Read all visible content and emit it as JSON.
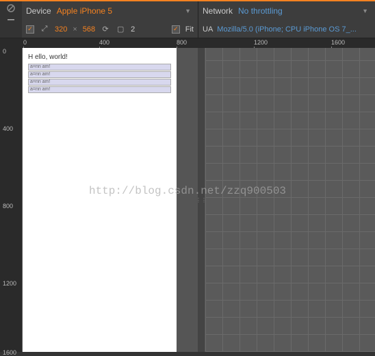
{
  "device": {
    "label": "Device",
    "selected": "Apple iPhone 5",
    "dimensions": {
      "width": "320",
      "height": "568",
      "separator": "×"
    },
    "zoom": "2",
    "fit_label": "Fit"
  },
  "network": {
    "label": "Network",
    "selected": "No throttling",
    "ua_label": "UA",
    "ua_value": "Mozilla/5.0 (iPhone; CPU iPhone OS 7_..."
  },
  "ruler": {
    "h": [
      "0",
      "400",
      "800",
      "1200",
      "1600"
    ],
    "v": [
      "0",
      "400",
      "800",
      "1200",
      "1600"
    ]
  },
  "page_content": {
    "title": "H ello, world!",
    "rows": [
      "a=nn am!",
      "a=nn am!",
      "a=nn am!",
      "a=nn am!"
    ]
  },
  "watermark": "http://blog.csdn.net/zzq900503"
}
